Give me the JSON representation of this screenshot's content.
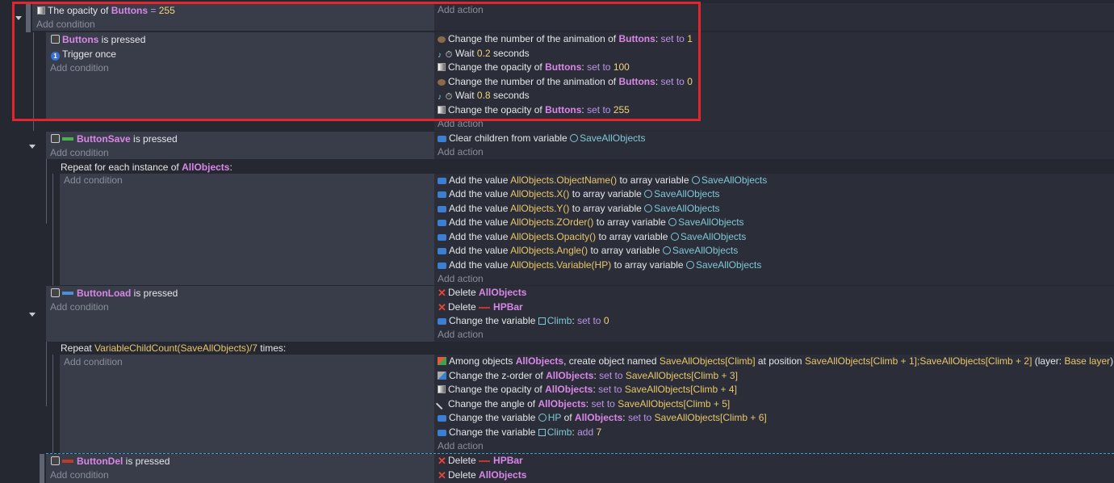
{
  "labels": {
    "add_condition": "Add condition",
    "add_action": "Add action"
  },
  "colors": {
    "highlight_box": "#e3262e",
    "condition_bg": "#393d4a",
    "action_bg": "#2b2e38",
    "object": "#d987e7",
    "operator": "#bd93e8",
    "number": "#f4d27a",
    "variable": "#7fc8d8"
  },
  "event1": {
    "condition": {
      "icon": "opacity-icon",
      "pre": "The opacity of",
      "object": "Buttons",
      "op": "=",
      "value": "255"
    }
  },
  "event2": {
    "cond1": {
      "icon": "mouse-icon",
      "object": "Buttons",
      "text": "is pressed"
    },
    "cond2": {
      "icon": "trigger-once-icon",
      "badge": "1",
      "text": "Trigger once"
    },
    "actions": [
      {
        "icon": "animation-icon",
        "pre": "Change the number of the animation of",
        "object": "Buttons",
        "colon": ":",
        "op": "set to",
        "value": "1"
      },
      {
        "icon": "wait-icon",
        "pre": "Wait",
        "value": "0.2",
        "post": "seconds"
      },
      {
        "icon": "opacity-icon",
        "pre": "Change the opacity of",
        "object": "Buttons",
        "colon": ":",
        "op": "set to",
        "value": "100"
      },
      {
        "icon": "animation-icon",
        "pre": "Change the number of the animation of",
        "object": "Buttons",
        "colon": ":",
        "op": "set to",
        "value": "0"
      },
      {
        "icon": "wait-icon",
        "pre": "Wait",
        "value": "0.8",
        "post": "seconds"
      },
      {
        "icon": "opacity-icon",
        "pre": "Change the opacity of",
        "object": "Buttons",
        "colon": ":",
        "op": "set to",
        "value": "255"
      }
    ]
  },
  "event3": {
    "cond": {
      "object": "ButtonSave",
      "text": "is pressed"
    },
    "action": {
      "pre": "Clear children from variable",
      "var": "SaveAllObjects"
    }
  },
  "repeat1": {
    "pre": "Repeat for each instance of",
    "object": "AllObjects",
    "colon": ":",
    "actions": [
      {
        "expr": "AllObjects.ObjectName()"
      },
      {
        "expr": "AllObjects.X()"
      },
      {
        "expr": "AllObjects.Y()"
      },
      {
        "expr": "AllObjects.ZOrder()"
      },
      {
        "expr": "AllObjects.Opacity()"
      },
      {
        "expr": "AllObjects.Angle()"
      },
      {
        "expr": "AllObjects.Variable(HP)"
      }
    ],
    "add_value": "Add the value",
    "to_array": "to array variable",
    "var": "SaveAllObjects"
  },
  "event4": {
    "cond": {
      "object": "ButtonLoad",
      "text": "is pressed"
    },
    "actions": [
      {
        "pre": "Delete",
        "object": "AllObjects"
      },
      {
        "pre": "Delete",
        "object": "HPBar"
      },
      {
        "pre": "Change the variable",
        "var": "Climb",
        "colon": ":",
        "op": "set to",
        "value": "0"
      }
    ]
  },
  "repeat2": {
    "pre": "Repeat",
    "expr": "VariableChildCount(SaveAllObjects)/7",
    "post": "times:",
    "a1": {
      "pre": "Among objects",
      "object": "AllObjects",
      "mid": ", create object named",
      "name": "SaveAllObjects[Climb]",
      "at": "at position",
      "pos": "SaveAllObjects[Climb + 1];SaveAllObjects[Climb + 2]",
      "layer_pre": "(layer:",
      "layer": "Base layer",
      "layer_post": ")"
    },
    "a2": {
      "pre": "Change the z-order of",
      "object": "AllObjects",
      "colon": ":",
      "op": "set to",
      "value": "SaveAllObjects[Climb + 3]"
    },
    "a3": {
      "pre": "Change the opacity of",
      "object": "AllObjects",
      "colon": ":",
      "op": "set to",
      "value": "SaveAllObjects[Climb + 4]"
    },
    "a4": {
      "pre": "Change the angle of",
      "object": "AllObjects",
      "colon": ":",
      "op": "set to",
      "value": "SaveAllObjects[Climb + 5]"
    },
    "a5": {
      "pre": "Change the variable",
      "var": "HP",
      "of": "of",
      "object": "AllObjects",
      "colon": ":",
      "op": "set to",
      "value": "SaveAllObjects[Climb + 6]"
    },
    "a6": {
      "pre": "Change the variable",
      "var": "Climb",
      "colon": ":",
      "op": "add",
      "value": "7"
    }
  },
  "event5": {
    "cond": {
      "object": "ButtonDel",
      "text": "is pressed"
    },
    "actions": [
      {
        "pre": "Delete",
        "object": "HPBar"
      },
      {
        "pre": "Delete",
        "object": "AllObjects"
      }
    ]
  }
}
